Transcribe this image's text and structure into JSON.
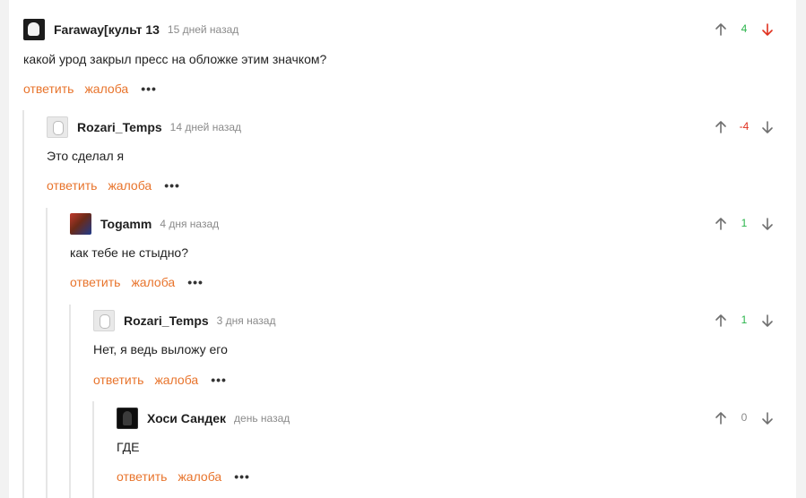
{
  "colors": {
    "link": "#e8742c",
    "positive": "#2ab44b",
    "negative": "#e0301e",
    "neutral": "#8a8a8a",
    "time": "#8a8a8a",
    "arrow": "#6f6f6f"
  },
  "comments": [
    {
      "author": "Faraway[культ 13",
      "time": "15 дней назад",
      "text": "какой урод закрыл пресс на обложке этим значком?",
      "score": "4",
      "reply_label": "ответить",
      "report_label": "жалоба",
      "more_label": "•••",
      "avatar_icon": "user-avatar-icon"
    },
    {
      "author": "Rozari_Temps",
      "time": "14 дней назад",
      "text": "Это сделал я",
      "score": "-4",
      "reply_label": "ответить",
      "report_label": "жалоба",
      "more_label": "•••",
      "avatar_icon": "user-avatar-icon"
    },
    {
      "author": "Togamm",
      "time": "4 дня назад",
      "text": "как тебе не стыдно?",
      "score": "1",
      "reply_label": "ответить",
      "report_label": "жалоба",
      "more_label": "•••",
      "avatar_icon": "user-avatar-icon"
    },
    {
      "author": "Rozari_Temps",
      "time": "3 дня назад",
      "text": "Нет, я ведь выложу его",
      "score": "1",
      "reply_label": "ответить",
      "report_label": "жалоба",
      "more_label": "•••",
      "avatar_icon": "user-avatar-icon"
    },
    {
      "author": "Хоси Сандек",
      "time": "день назад",
      "text": "ГДЕ",
      "score": "0",
      "reply_label": "ответить",
      "report_label": "жалоба",
      "more_label": "•••",
      "avatar_icon": "user-avatar-icon"
    }
  ]
}
